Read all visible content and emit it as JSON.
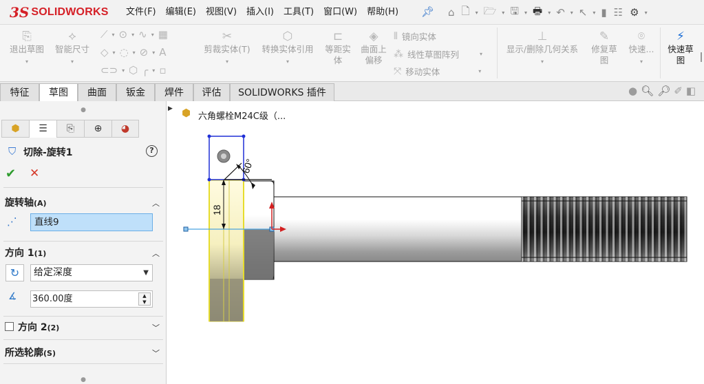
{
  "app": {
    "logo_prefix": "3S",
    "logo_text": "SOLIDWORKS"
  },
  "menu": [
    "文件(F)",
    "编辑(E)",
    "视图(V)",
    "插入(I)",
    "工具(T)",
    "窗口(W)",
    "帮助(H)"
  ],
  "ribbon": {
    "exit_sketch": "退出草图",
    "smart_dim": "智能尺寸",
    "trim": "剪裁实体(T)",
    "convert": "转换实体引用",
    "offset_line1": "等距实",
    "offset_line2": "体",
    "offset_surface_line1": "曲面上",
    "offset_surface_line2": "偏移",
    "mirror": "镜向实体",
    "linear_pattern": "线性草图阵列",
    "move": "移动实体",
    "display_relations": "显示/删除几何关系",
    "repair_line1": "修复草",
    "repair_line2": "图",
    "quick_snaps": "快速...",
    "rapid_sketch_line1": "快速草",
    "rapid_sketch_line2": "图"
  },
  "tabs": [
    "特征",
    "草图",
    "曲面",
    "钣金",
    "焊件",
    "评估",
    "SOLIDWORKS 插件"
  ],
  "active_tab": "草图",
  "property_manager": {
    "title": "切除-旋转1",
    "help": "?",
    "axis_section": "旋转轴",
    "axis_section_key": "(A)",
    "axis_value": "直线9",
    "direction1_section": "方向 1",
    "direction1_key": "(1)",
    "end_condition": "给定深度",
    "angle": "360.00度",
    "direction2_section": "方向 2",
    "direction2_key": "(2)",
    "contours_section": "所选轮廓",
    "contours_key": "(S)"
  },
  "tree": {
    "part_name": "六角螺栓M24C级（..."
  },
  "sketch": {
    "dim_length": "18",
    "dim_angle": "60°"
  },
  "colors": {
    "brand": "#d52027",
    "selection": "#bfe0fa",
    "sketch_blue": "#1f2fd6",
    "highlight_yellow": "#fbf6b9"
  }
}
